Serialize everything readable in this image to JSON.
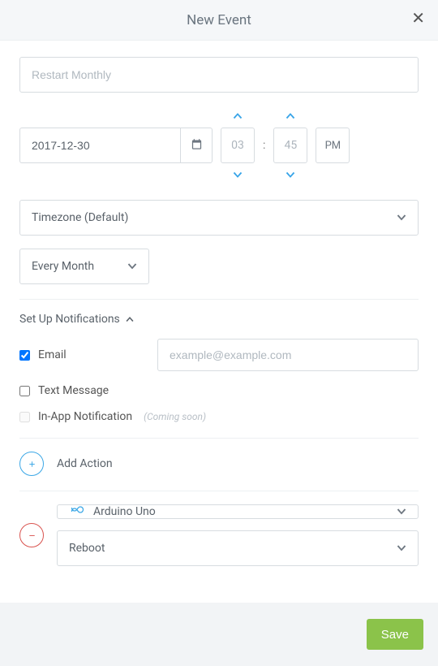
{
  "header": {
    "title": "New Event"
  },
  "name_input": {
    "placeholder": "Restart Monthly",
    "value": ""
  },
  "date": {
    "value": "2017-12-30"
  },
  "time": {
    "hour": "03",
    "minute": "45",
    "ampm": "PM"
  },
  "timezone": {
    "label": "Timezone (Default)"
  },
  "recurrence": {
    "label": "Every Month"
  },
  "notifications": {
    "header": "Set Up Notifications",
    "email": {
      "label": "Email",
      "checked": true,
      "placeholder": "example@example.com",
      "value": ""
    },
    "text": {
      "label": "Text Message",
      "checked": false
    },
    "inapp": {
      "label": "In-App Notification",
      "coming_soon": "(Coming soon)",
      "checked": false
    }
  },
  "actions": {
    "add_label": "Add Action",
    "items": [
      {
        "device": "Arduino Uno",
        "action": "Reboot"
      }
    ]
  },
  "footer": {
    "save": "Save"
  },
  "colors": {
    "accent": "#3ba7e6",
    "success": "#8bc34a",
    "danger": "#d9534f"
  }
}
